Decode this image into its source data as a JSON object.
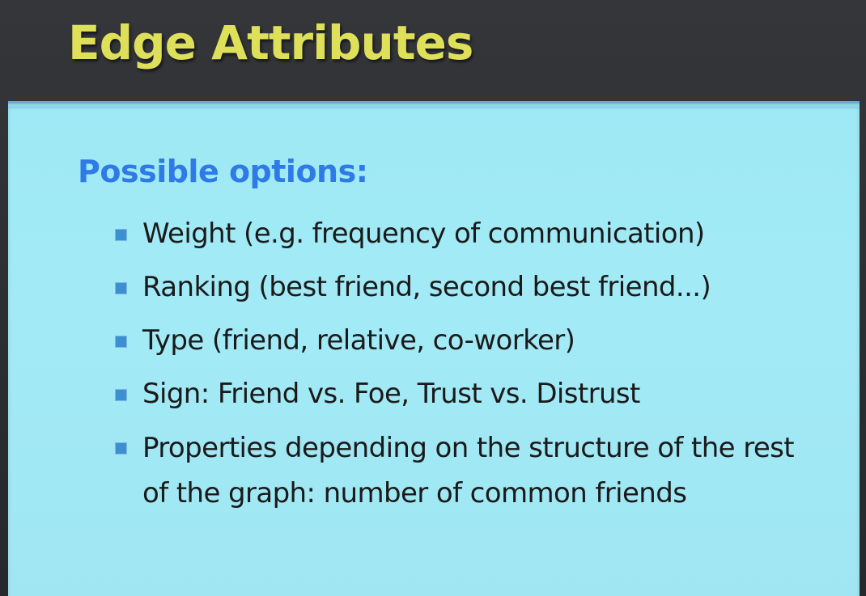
{
  "slide": {
    "title": "Edge Attributes",
    "heading": "Possible options:",
    "bullets": [
      {
        "text": "Weight (e.g. frequency of communication)"
      },
      {
        "text": "Ranking (best friend, second best friend...)"
      },
      {
        "text": "Type (friend, relative, co-worker)"
      },
      {
        "text": "Sign: Friend vs. Foe, Trust vs. Distrust"
      },
      {
        "line1": "Properties depending on the structure of the rest",
        "line2": "of the graph: number of common friends"
      }
    ]
  },
  "colors": {
    "title": "#dfe05a",
    "heading": "#2f7be6",
    "panel_background": "#a2eaf6",
    "bullet": "#3c8fd0",
    "frame_background": "#2b2d31"
  },
  "icons": {
    "bullet": "square-bullet-icon"
  }
}
